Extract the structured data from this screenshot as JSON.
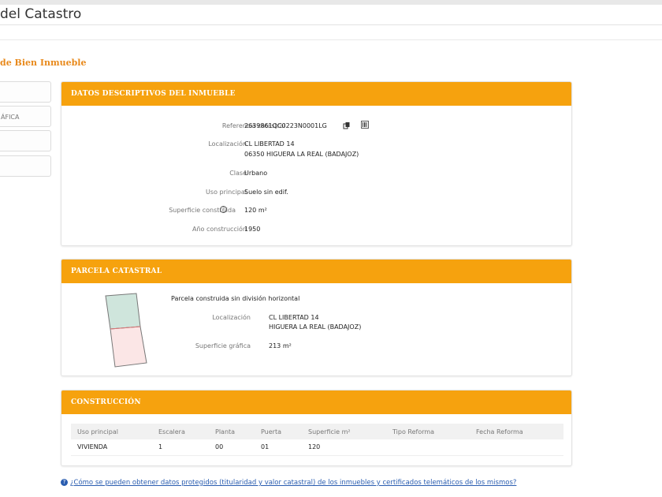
{
  "header": {
    "title": "del Catastro"
  },
  "section_title": "de Bien Inmueble",
  "sidebar": {
    "items": [
      {
        "label": ""
      },
      {
        "label": "ÁFICA"
      },
      {
        "label": ""
      },
      {
        "label": ""
      }
    ]
  },
  "datos": {
    "heading": "DATOS DESCRIPTIVOS DEL INMUEBLE",
    "rows": [
      {
        "label": "Referencia catastral",
        "value": "2639861QC0223N0001LG"
      },
      {
        "label": "Localización",
        "value": "CL LIBERTAD 14",
        "value2": "06350 HIGUERA LA REAL (BADAJOZ)"
      },
      {
        "label": "Clase",
        "value": "Urbano"
      },
      {
        "label": "Uso principal",
        "value": "Suelo sin edif."
      },
      {
        "label": "Superficie construida",
        "value": "120 m²"
      },
      {
        "label": "Año construcción",
        "value": "1950"
      }
    ]
  },
  "parcela": {
    "heading": "PARCELA CATASTRAL",
    "subtitle": "Parcela construida sin división horizontal",
    "localizacion_label": "Localización",
    "localizacion_1": "CL LIBERTAD 14",
    "localizacion_2": "HIGUERA LA REAL (BADAJOZ)",
    "superficie_label": "Superficie gráfica",
    "superficie_value": "213 m²"
  },
  "construccion": {
    "heading": "CONSTRUCCIÓN",
    "columns": [
      "Uso principal",
      "Escalera",
      "Planta",
      "Puerta",
      "Superficie m²",
      "Tipo Reforma",
      "Fecha Reforma"
    ],
    "rows": [
      [
        "VIVIENDA",
        "1",
        "00",
        "01",
        "120",
        "",
        ""
      ]
    ]
  },
  "footer": {
    "link": "¿Cómo se pueden obtener datos protegidos (titularidad y valor catastral) de los inmuebles y certificados telemáticos de los mismos?"
  },
  "colors": {
    "accent": "#f6a20e",
    "title_orange": "#e8891b",
    "link": "#2a5db0"
  }
}
